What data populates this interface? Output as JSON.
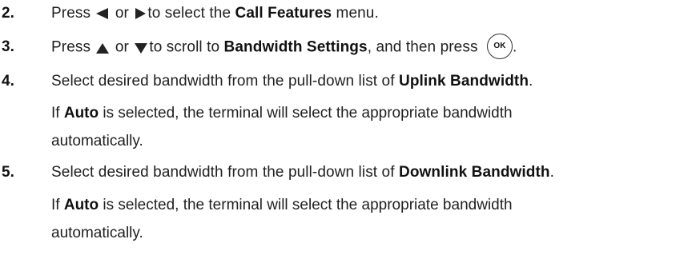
{
  "steps": [
    {
      "number": "2.",
      "prefix": "Press",
      "connector": "or",
      "after_icons": "to select the",
      "bold": "Call Features",
      "suffix": "menu."
    },
    {
      "number": "3.",
      "prefix": "Press",
      "connector": "or",
      "after_icons": "to scroll to",
      "bold": "Bandwidth Settings",
      "suffix": ", and then press",
      "ok_label": "OK",
      "end": "."
    },
    {
      "number": "4.",
      "text": "Select desired bandwidth from the pull-down list of",
      "bold": "Uplink Bandwidth",
      "end": ".",
      "note": {
        "prefix": "If",
        "bold": "Auto",
        "line1": "is selected, the terminal will select the appropriate bandwidth",
        "line2": "automatically."
      }
    },
    {
      "number": "5.",
      "text": "Select desired bandwidth from the pull-down list of",
      "bold": "Downlink Bandwidth",
      "end": ".",
      "note": {
        "prefix": "If",
        "bold": "Auto",
        "line1": "is selected, the terminal will select the appropriate bandwidth",
        "line2": "automatically."
      }
    }
  ],
  "icons": {
    "left": "left-arrow-icon",
    "right": "right-arrow-icon",
    "up": "up-arrow-icon",
    "down": "down-arrow-icon",
    "ok": "ok-button-icon"
  }
}
